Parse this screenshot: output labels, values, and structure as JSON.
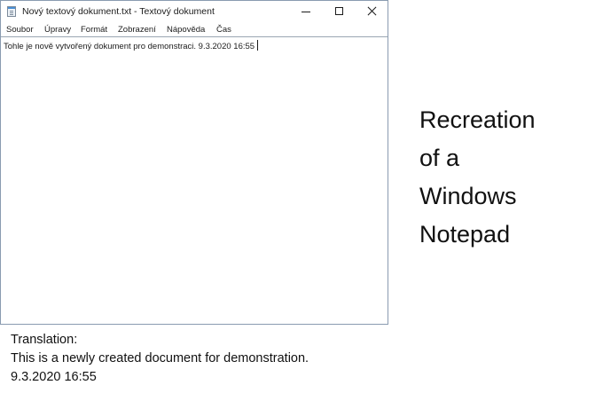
{
  "window": {
    "title": "Nový textový dokument.txt - Textový dokument",
    "app_icon": "notepad-icon",
    "controls": {
      "minimize_icon": "minimize-icon",
      "maximize_icon": "maximize-icon",
      "close_icon": "close-icon"
    }
  },
  "menubar": {
    "items": [
      {
        "label": "Soubor"
      },
      {
        "label": "Úpravy"
      },
      {
        "label": "Formát"
      },
      {
        "label": "Zobrazení"
      },
      {
        "label": "Nápověda"
      },
      {
        "label": "Čas"
      }
    ]
  },
  "editor": {
    "text": "Tohle je nově vytvořený dokument pro demonstraci. 9.3.2020 16:55"
  },
  "caption": {
    "lines": [
      "Recreation",
      "of a",
      "Windows",
      "Notepad"
    ]
  },
  "translation": {
    "heading": "Translation:",
    "line1": "This is a newly created document for demonstration.",
    "line2": "9.3.2020 16:55"
  },
  "colors": {
    "window_border": "#8a9bb0",
    "icon_accent": "#4a8fd6",
    "text": "#1b1b1b"
  }
}
